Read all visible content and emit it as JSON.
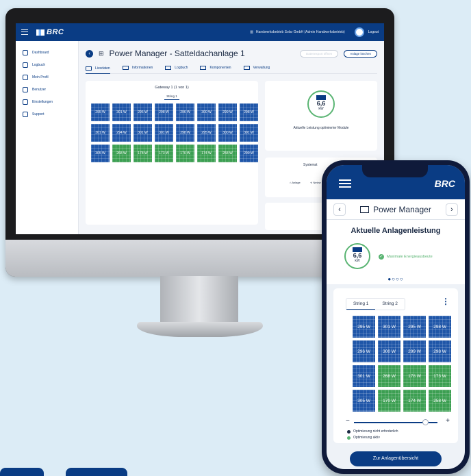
{
  "desktop": {
    "brand": "BRC",
    "company": "Handwerksbetrieb Solar GmbH (Admin Handwerksbetrieb)",
    "logout": "Logout",
    "nav": [
      "Dashboard",
      "Logbuch",
      "Mein Profil",
      "Benutzer",
      "Einstellungen",
      "Support"
    ],
    "page_title": "Power Manager - Satteldachanlage 1",
    "btn_ghost": "Datenexport öffnen",
    "btn_primary": "Anlage löschen",
    "tabs": [
      "Livedaten",
      "Informationen",
      "Logbuch",
      "Komponenten",
      "Verwaltung"
    ],
    "gateway_title": "Gateway 1 (1 von 1)",
    "string_label": "String 1",
    "panels": [
      {
        "v": "295 W",
        "opt": false
      },
      {
        "v": "301 W",
        "opt": false
      },
      {
        "v": "295 W",
        "opt": false
      },
      {
        "v": "298 W",
        "opt": false
      },
      {
        "v": "296 W",
        "opt": false
      },
      {
        "v": "300 W",
        "opt": false
      },
      {
        "v": "299 W",
        "opt": false
      },
      {
        "v": "298 W",
        "opt": false
      },
      {
        "v": "301 W",
        "opt": false
      },
      {
        "v": "294 W",
        "opt": false
      },
      {
        "v": "301 W",
        "opt": false
      },
      {
        "v": "301 W",
        "opt": false
      },
      {
        "v": "298 W",
        "opt": false
      },
      {
        "v": "295 W",
        "opt": false
      },
      {
        "v": "300 W",
        "opt": false
      },
      {
        "v": "301 W",
        "opt": false
      },
      {
        "v": "305 W",
        "opt": false
      },
      {
        "v": "268 W",
        "opt": true
      },
      {
        "v": "178 W",
        "opt": true
      },
      {
        "v": "173 W",
        "opt": true
      },
      {
        "v": "170 W",
        "opt": true
      },
      {
        "v": "174 W",
        "opt": true
      },
      {
        "v": "258 W",
        "opt": true
      },
      {
        "v": "299 W",
        "opt": false
      }
    ],
    "power_value": "6,6",
    "power_unit": "kW",
    "power_label": "Aktuelle Leistung optimierter Module",
    "system_title": "Systemst",
    "system_items": [
      "Anlage",
      "Netzw"
    ]
  },
  "phone": {
    "brand": "BRC",
    "title": "Power Manager",
    "power_title": "Aktuelle Anlagenleistung",
    "power_value": "6,6",
    "power_unit": "kW",
    "status": "Maximale Energieausbeute",
    "dots": "●○○○",
    "string_tabs": [
      "String 1",
      "String 2"
    ],
    "panels": [
      {
        "v": "295 W",
        "opt": false
      },
      {
        "v": "301 W",
        "opt": false
      },
      {
        "v": "295 W",
        "opt": false
      },
      {
        "v": "298 W",
        "opt": false
      },
      {
        "v": "296 W",
        "opt": false
      },
      {
        "v": "300 W",
        "opt": false
      },
      {
        "v": "299 W",
        "opt": false
      },
      {
        "v": "298 W",
        "opt": false
      },
      {
        "v": "301 W",
        "opt": false
      },
      {
        "v": "268 W",
        "opt": true
      },
      {
        "v": "178 W",
        "opt": true
      },
      {
        "v": "173 W",
        "opt": true
      },
      {
        "v": "305 W",
        "opt": false
      },
      {
        "v": "170 W",
        "opt": true
      },
      {
        "v": "174 W",
        "opt": true
      },
      {
        "v": "258 W",
        "opt": true
      }
    ],
    "legend_not_needed": "Optimierung nicht erforderlich",
    "legend_active": "Optimierung aktiv",
    "cta": "Zur Anlagenübersicht"
  },
  "colors": {
    "brand_blue": "#0a3c84",
    "panel_blue": "#1f56a8",
    "panel_green": "#3c9f52",
    "accent_green": "#59b472"
  }
}
